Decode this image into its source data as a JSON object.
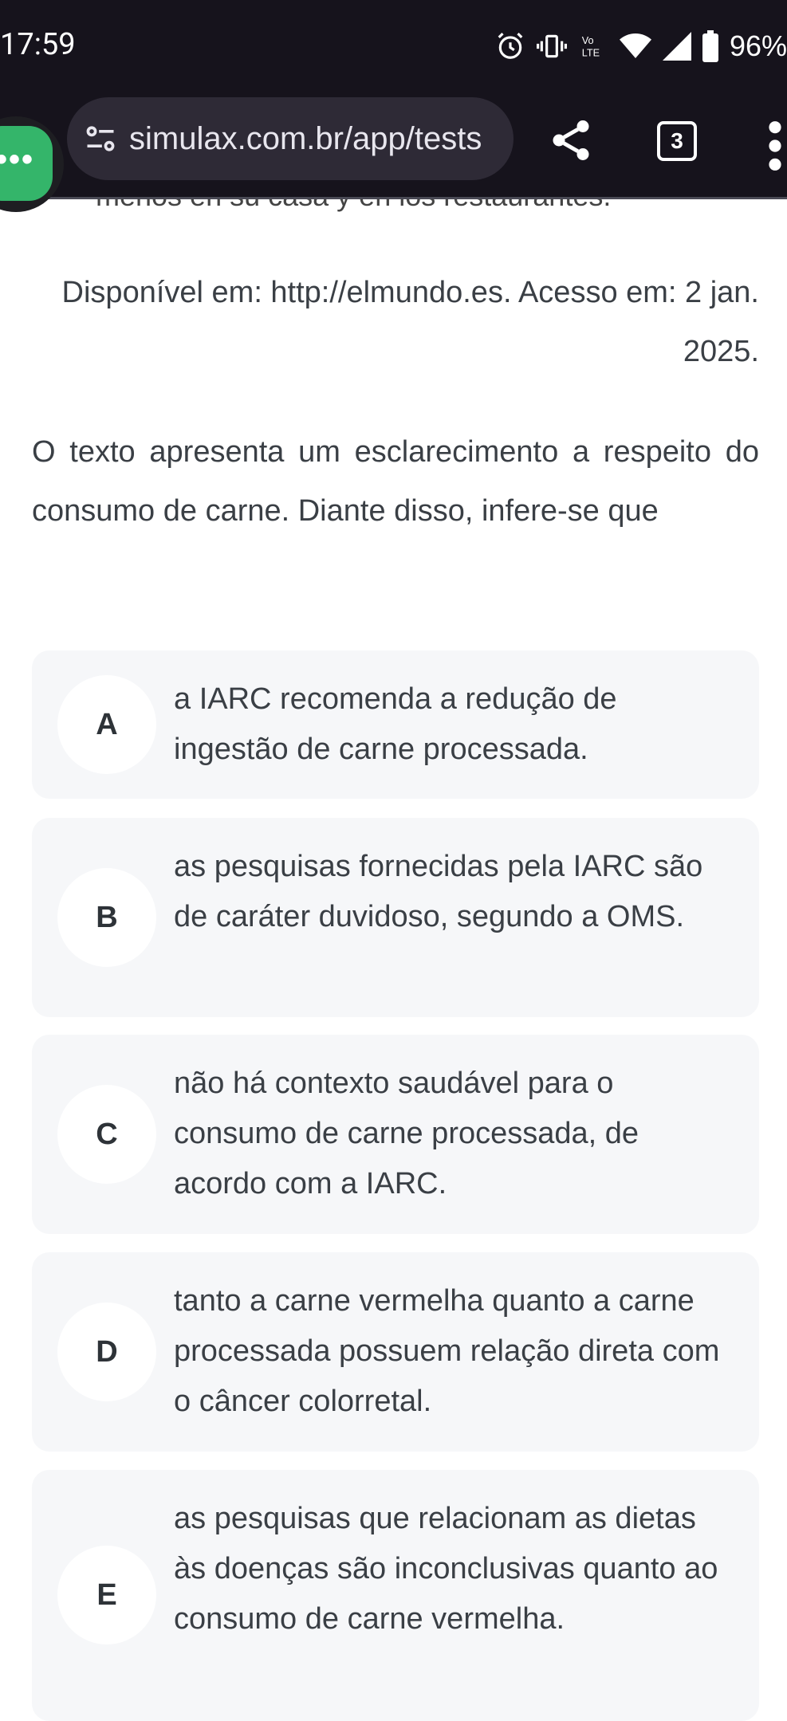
{
  "status_bar": {
    "time": "17:59",
    "battery": "96%",
    "icons": [
      "alarm-icon",
      "vibrate-icon",
      "volte-icon",
      "wifi-icon",
      "signal-icon",
      "battery-icon"
    ]
  },
  "browser": {
    "url": "simulax.com.br/app/tests",
    "tab_count": "3"
  },
  "content": {
    "cut_line": "menos en su casa y en los restaurantes.",
    "source": "Disponível em: http://elmundo.es. Acesso em: 2 jan. 2025.",
    "question": "O texto apresenta um esclarecimento a respeito do consumo de carne. Diante disso, infere-se que"
  },
  "options": [
    {
      "letter": "A",
      "text": "a IARC recomenda a redução de ingestão de carne processada."
    },
    {
      "letter": "B",
      "text": "as pesquisas fornecidas pela IARC são de caráter duvidoso, segundo a OMS."
    },
    {
      "letter": "C",
      "text": "não há contexto saudável para o consumo de carne processada, de acordo com a IARC."
    },
    {
      "letter": "D",
      "text": "tanto a carne vermelha quanto a carne processada possuem relação direta com o câncer colorretal."
    },
    {
      "letter": "E",
      "text": "as pesquisas que relacionam as dietas às doenças são inconclusivas quanto ao consumo de carne vermelha."
    }
  ],
  "colors": {
    "bar_bg": "#16131c",
    "option_bg": "#f6f7f9",
    "bubble_green": "#34b56a"
  }
}
